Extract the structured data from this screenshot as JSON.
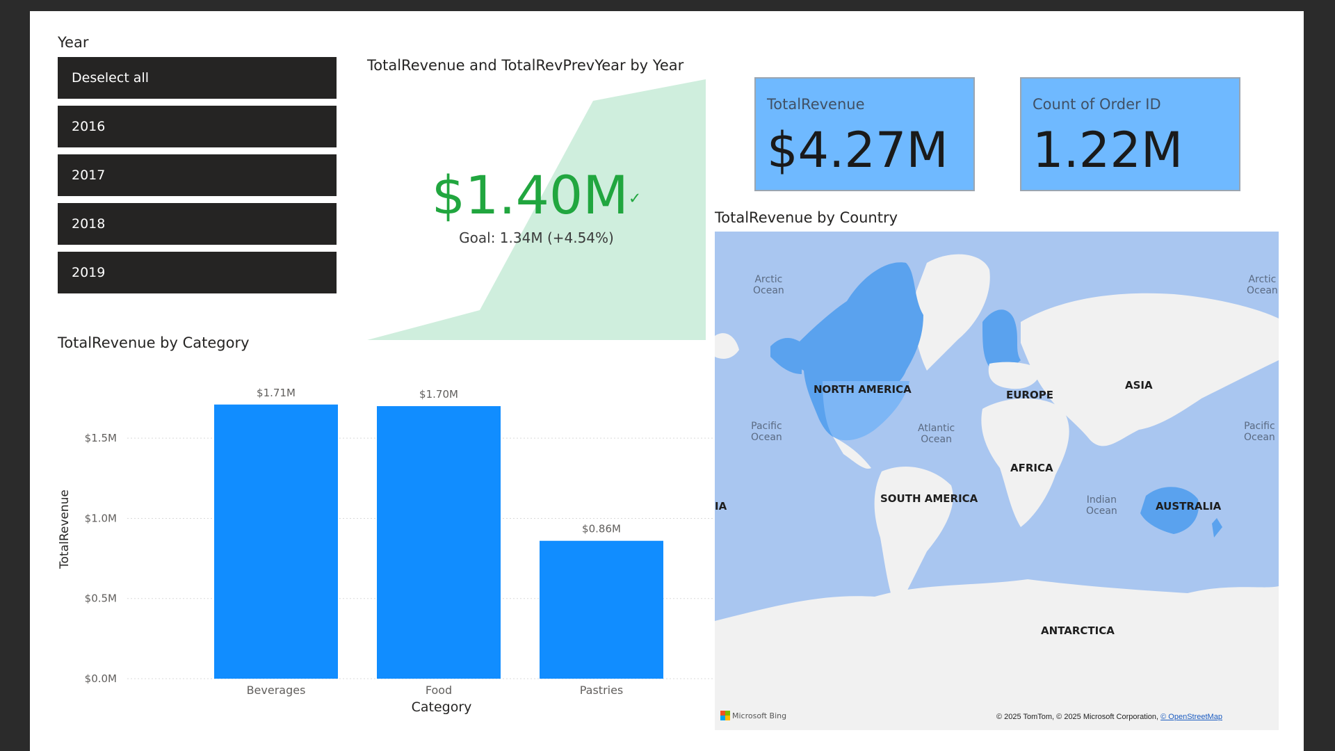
{
  "slicer": {
    "title": "Year",
    "items": [
      {
        "label": "Deselect all"
      },
      {
        "label": "2016"
      },
      {
        "label": "2017"
      },
      {
        "label": "2018"
      },
      {
        "label": "2019"
      }
    ]
  },
  "kpi": {
    "title": "TotalRevenue and TotalRevPrevYear by Year",
    "value": "$1.40M",
    "check_glyph": "✓",
    "goal": "Goal: 1.34M (+4.54%)",
    "color": "#21a63f",
    "trend_fill_color": "#cfeedd"
  },
  "cards": [
    {
      "label": "TotalRevenue",
      "value": "$4.27M"
    },
    {
      "label": "Count of Order ID",
      "value": "1.22M"
    }
  ],
  "bar_chart": {
    "title": "TotalRevenue by Category"
  },
  "chart_data": {
    "type": "bar",
    "title": "TotalRevenue by Category",
    "categories": [
      "Beverages",
      "Food",
      "Pastries"
    ],
    "values": [
      1.71,
      1.7,
      0.86
    ],
    "data_labels": [
      "$1.71M",
      "$1.70M",
      "$0.86M"
    ],
    "xlabel": "Category",
    "ylabel": "TotalRevenue",
    "ylim": [
      0,
      1.8
    ],
    "yticks": [
      0,
      0.5,
      1.0,
      1.5
    ],
    "ytick_labels": [
      "$0.0M",
      "$0.5M",
      "$1.0M",
      "$1.5M"
    ],
    "grid": true,
    "bar_color": "#118dff"
  },
  "map": {
    "title": "TotalRevenue by Country",
    "continents": [
      "NORTH AMERICA",
      "EUROPE",
      "ASIA",
      "AFRICA",
      "SOUTH AMERICA",
      "AUSTRALIA",
      "ANTARCTICA",
      "IA"
    ],
    "oceans": [
      "Arctic\nOcean",
      "Arctic\nOcean",
      "Pacific\nOcean",
      "Atlantic\nOcean",
      "Pacific\nOcean",
      "Indian\nOcean"
    ],
    "logo": "Microsoft Bing",
    "attribution": "© 2025 TomTom, © 2025 Microsoft Corporation, ",
    "attribution_link": "© OpenStreetMap"
  }
}
